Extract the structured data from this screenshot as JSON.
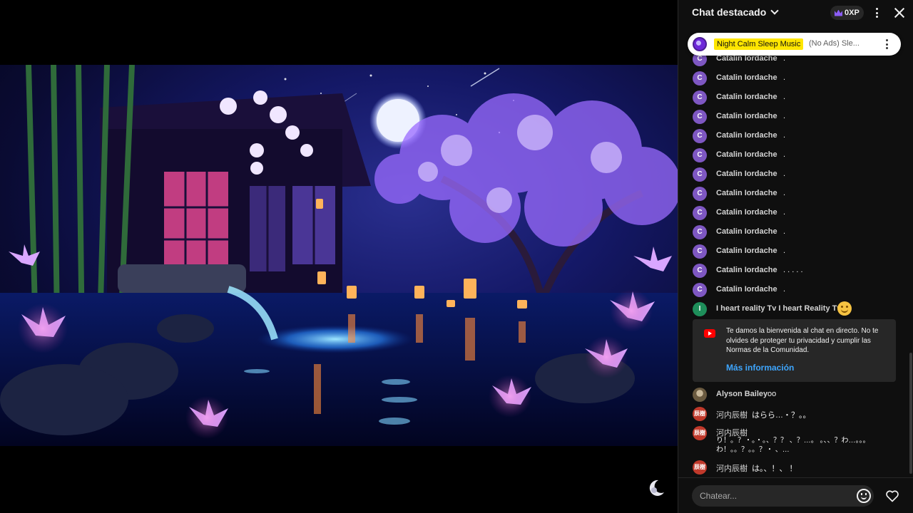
{
  "chat": {
    "title": "Chat destacado",
    "points": "0XP",
    "pinned": {
      "name": "Night Calm Sleep Music",
      "text": "(No Ads) Sle..."
    },
    "messages": [
      {
        "initial": "C",
        "author": "Catalin Iordache",
        "text": "."
      },
      {
        "initial": "C",
        "author": "Catalin Iordache",
        "text": "."
      },
      {
        "initial": "C",
        "author": "Catalin Iordache",
        "text": "."
      },
      {
        "initial": "C",
        "author": "Catalin Iordache",
        "text": "."
      },
      {
        "initial": "C",
        "author": "Catalin Iordache",
        "text": "."
      },
      {
        "initial": "C",
        "author": "Catalin Iordache",
        "text": "."
      },
      {
        "initial": "C",
        "author": "Catalin Iordache",
        "text": "."
      },
      {
        "initial": "C",
        "author": "Catalin Iordache",
        "text": "."
      },
      {
        "initial": "C",
        "author": "Catalin Iordache",
        "text": "."
      },
      {
        "initial": "C",
        "author": "Catalin Iordache",
        "text": "."
      },
      {
        "initial": "C",
        "author": "Catalin Iordache",
        "text": "."
      },
      {
        "initial": "C",
        "author": "Catalin Iordache",
        "text": ". . . . ."
      },
      {
        "initial": "C",
        "author": "Catalin Iordache",
        "text": "."
      },
      {
        "initial": "I",
        "author": "I heart reality Tv I heart Reality Tv",
        "text": ""
      }
    ],
    "notice": {
      "text": "Te damos la bienvenida al chat en directo. No te olvides de proteger tu privacidad y cumplir las Normas de la Comunidad.",
      "link": "Más información"
    },
    "lower_messages": [
      {
        "initial": "",
        "author": "Alyson Bailey",
        "text": "oo"
      },
      {
        "initial": "辰樹",
        "author": "河内辰樹",
        "text": "はらら…・？。。"
      },
      {
        "initial": "辰樹",
        "author": "河内辰樹",
        "text": "り！。？・。・。、？？ 、？…。 。、、？わ…。。。わ！。。？。。？・ 、…"
      },
      {
        "initial": "辰樹",
        "author": "河内辰樹",
        "text": "は。、！、 ！"
      }
    ],
    "input_placeholder": "Chatear..."
  },
  "icons": {
    "dropdown": "chevron-down-icon",
    "points": "crown-icon",
    "menu": "more-vert-icon",
    "close": "close-icon",
    "emoji": "smiley-icon",
    "heart": "heart-icon",
    "notice": "youtube-icon"
  }
}
